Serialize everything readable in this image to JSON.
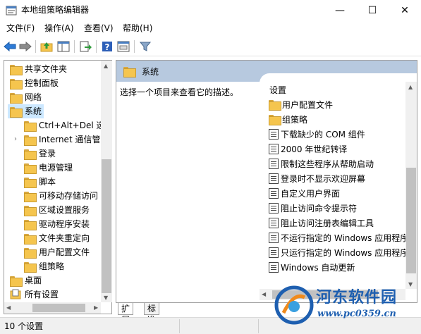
{
  "window": {
    "title": "本地组策略编辑器",
    "controls": {
      "minimize": "—",
      "maximize": "☐",
      "close": "✕"
    }
  },
  "menu": [
    {
      "label": "文件(F)"
    },
    {
      "label": "操作(A)"
    },
    {
      "label": "查看(V)"
    },
    {
      "label": "帮助(H)"
    }
  ],
  "toolbar": {
    "icons": [
      "back-icon",
      "forward-icon",
      "up-folder-icon",
      "show-hide-tree-icon",
      "export-list-icon",
      "help-icon",
      "view-icon",
      "filter-icon"
    ]
  },
  "tree": {
    "items": [
      {
        "label": "共享文件夹",
        "level": 1
      },
      {
        "label": "控制面板",
        "level": 1
      },
      {
        "label": "网络",
        "level": 1
      },
      {
        "label": "系统",
        "level": 1,
        "selected": true
      },
      {
        "label": "Ctrl+Alt+Del 选",
        "level": 2
      },
      {
        "label": "Internet 通信管",
        "level": 2,
        "expandable": true
      },
      {
        "label": "登录",
        "level": 2
      },
      {
        "label": "电源管理",
        "level": 2
      },
      {
        "label": "脚本",
        "level": 2
      },
      {
        "label": "可移动存储访问",
        "level": 2
      },
      {
        "label": "区域设置服务",
        "level": 2
      },
      {
        "label": "驱动程序安装",
        "level": 2
      },
      {
        "label": "文件夹重定向",
        "level": 2
      },
      {
        "label": "用户配置文件",
        "level": 2
      },
      {
        "label": "组策略",
        "level": 2
      },
      {
        "label": "桌面",
        "level": 1
      },
      {
        "label": "所有设置",
        "level": 1
      }
    ]
  },
  "details": {
    "header": "系统",
    "description": "选择一个项目来查看它的描述。",
    "column_header": "设置",
    "items": [
      {
        "label": "用户配置文件",
        "icon": "folder-icon"
      },
      {
        "label": "组策略",
        "icon": "folder-icon"
      },
      {
        "label": "下载缺少的 COM 组件",
        "icon": "setting-icon"
      },
      {
        "label": "2000 年世纪转译",
        "icon": "setting-icon"
      },
      {
        "label": "限制这些程序从帮助启动",
        "icon": "setting-icon"
      },
      {
        "label": "登录时不显示欢迎屏幕",
        "icon": "setting-icon"
      },
      {
        "label": "自定义用户界面",
        "icon": "setting-icon"
      },
      {
        "label": "阻止访问命令提示符",
        "icon": "setting-icon"
      },
      {
        "label": "阻止访问注册表编辑工具",
        "icon": "setting-icon"
      },
      {
        "label": "不运行指定的 Windows 应用程序",
        "icon": "setting-icon"
      },
      {
        "label": "只运行指定的 Windows 应用程序",
        "icon": "setting-icon"
      },
      {
        "label": "Windows 自动更新",
        "icon": "setting-icon"
      }
    ]
  },
  "tabs": [
    {
      "label": "扩展"
    },
    {
      "label": "标准"
    }
  ],
  "status": {
    "text": "10 个设置"
  },
  "watermark": {
    "title": "河东软件园",
    "url": "www.pc0359.cn"
  },
  "colors": {
    "header_bg": "#b7c9df",
    "selected_bg": "#cce8ff",
    "watermark": "#1e5fb0"
  }
}
